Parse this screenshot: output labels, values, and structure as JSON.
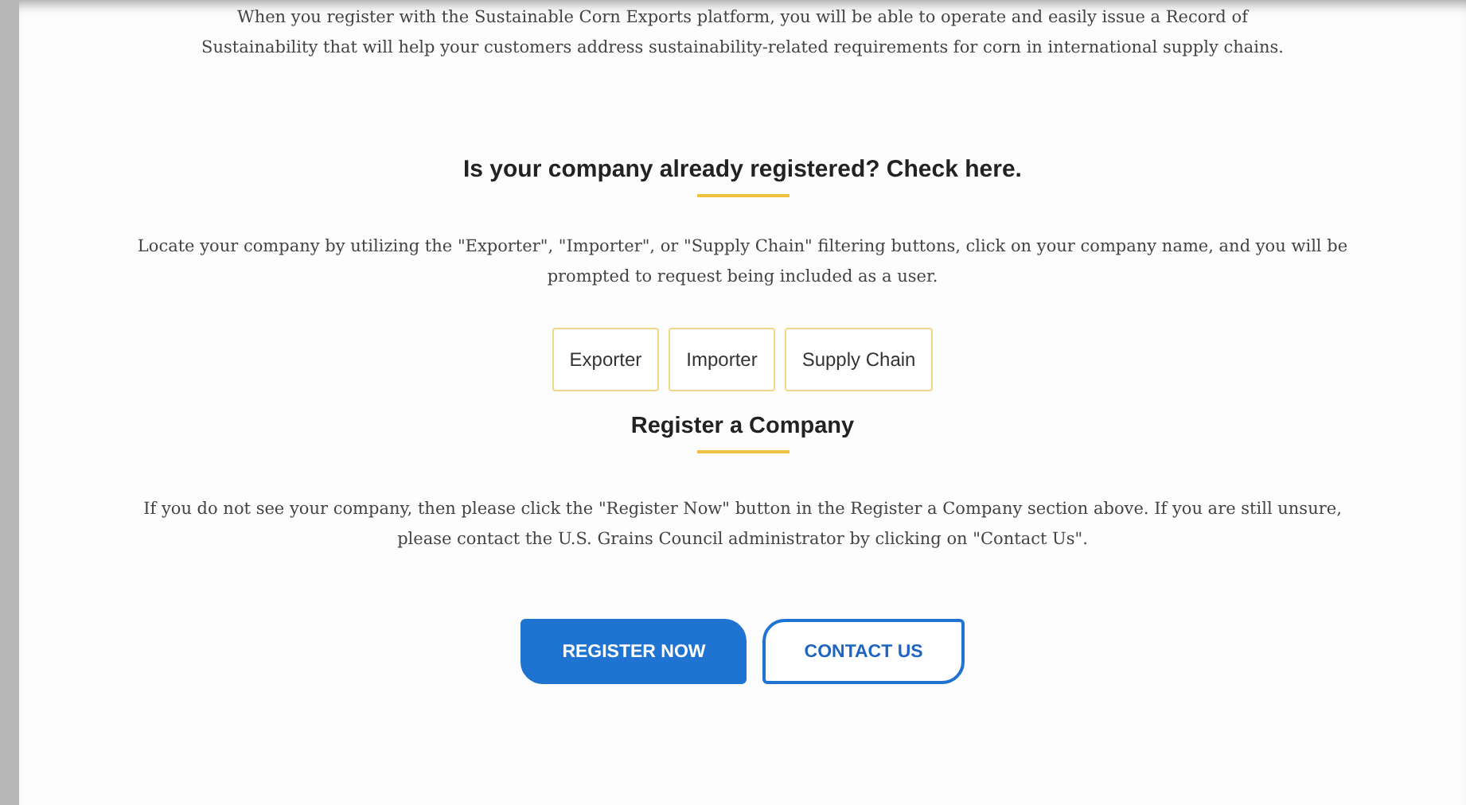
{
  "intro": "When you register with the Sustainable Corn Exports platform, you will be able to operate and easily issue a Record of Sustainability that will help your customers address sustainability-related requirements for corn in international supply chains.",
  "check_section": {
    "heading": "Is your company already registered? Check here.",
    "text": "Locate your company by utilizing the \"Exporter\", \"Importer\", or \"Supply Chain\" filtering buttons, click on your company name, and you will be prompted to request being included as a user.",
    "filters": [
      "Exporter",
      "Importer",
      "Supply Chain"
    ]
  },
  "register_section": {
    "heading": "Register a Company",
    "text": "If you do not see your company, then please click the \"Register Now\" button in the Register a Company section above. If you are still unsure, please contact the U.S. Grains Council administrator by clicking on \"Contact Us\".",
    "buttons": [
      {
        "label": "REGISTER NOW",
        "kind": "primary"
      },
      {
        "label": "CONTACT US",
        "kind": "outline"
      }
    ]
  }
}
